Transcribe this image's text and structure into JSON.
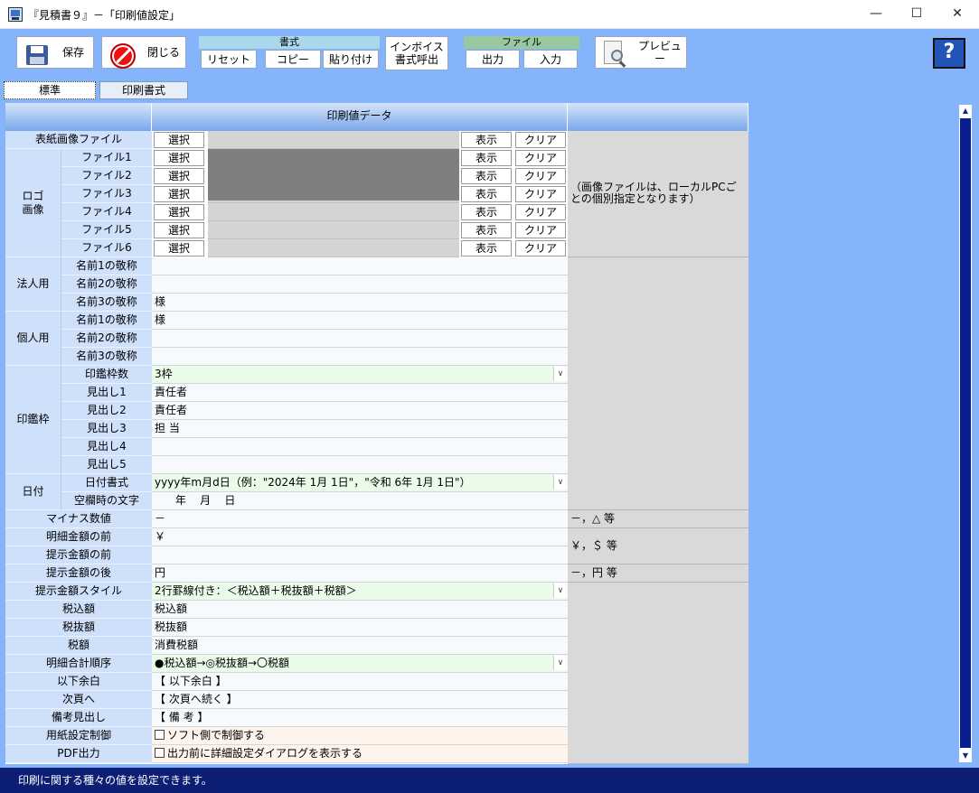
{
  "window": {
    "title": "『見積書９』－「印刷値設定」",
    "minimize": "—",
    "maximize": "☐",
    "close": "✕"
  },
  "toolbar": {
    "save": "保存",
    "close": "閉じる",
    "format_group": "書式",
    "reset": "リセット",
    "copy": "コピー",
    "paste": "貼り付け",
    "invoice": "インボイス\n書式呼出",
    "file_group": "ファイル",
    "export": "出力",
    "import": "入力",
    "preview": "プレビュー",
    "help": "?"
  },
  "tabs": [
    "標準",
    "印刷書式"
  ],
  "grid": {
    "header": "印刷値データ",
    "cover_label": "表紙画像ファイル",
    "logo_group": "ロゴ\n画像",
    "logo_files": [
      "ファイル1",
      "ファイル2",
      "ファイル3",
      "ファイル4",
      "ファイル5",
      "ファイル6"
    ],
    "select": "選択",
    "show": "表示",
    "clear": "クリア",
    "image_note": "（画像ファイルは、ローカルPCごとの個別指定となります）",
    "corp_group": "法人用",
    "personal_group": "個人用",
    "name_titles": [
      "名前1の敬称",
      "名前2の敬称",
      "名前3の敬称"
    ],
    "corp_values": [
      "",
      "",
      "様"
    ],
    "personal_values": [
      "様",
      "",
      ""
    ],
    "stamp_group": "印鑑枠",
    "stamp_count_label": "印鑑枠数",
    "stamp_count_value": "3枠",
    "stamp_heads": [
      "見出し1",
      "見出し2",
      "見出し3",
      "見出し4",
      "見出し5"
    ],
    "stamp_head_values": [
      "責任者",
      "責任者",
      "担 当",
      "",
      ""
    ],
    "date_group": "日付",
    "date_format_label": "日付書式",
    "date_format_value": "yyyy年m月d日（例：\"2024年 1月 1日\"，\"令和 6年 1月 1日\"）",
    "blank_label": "空欄時の文字",
    "blank_value": "      年    月    日",
    "minus_label": "マイナス数値",
    "minus_value": "－",
    "minus_note": "－，△ 等",
    "detail_before_label": "明細金額の前",
    "detail_before_value": "￥",
    "currency_note": "￥，＄ 等",
    "present_before_label": "提示金額の前",
    "present_before_value": "",
    "present_after_label": "提示金額の後",
    "present_after_value": "円",
    "after_note": "－，円 等",
    "style_label": "提示金額スタイル",
    "style_value": "2行罫線付き：＜税込額＋税抜額＋税額＞",
    "taxin_label": "税込額",
    "taxin_value": "税込額",
    "taxex_label": "税抜額",
    "taxex_value": "税抜額",
    "tax_label": "税額",
    "tax_value": "消費税額",
    "order_label": "明細合計順序",
    "order_value": "●税込額→◎税抜額→〇税額",
    "below_label": "以下余白",
    "below_value": "【 以下余白 】",
    "next_label": "次頁へ",
    "next_value": "【 次頁へ続く 】",
    "remark_label": "備考見出し",
    "remark_value": "【 備 考 】",
    "paper_label": "用紙設定制御",
    "paper_value": "ソフト側で制御する",
    "pdf_label": "PDF出力",
    "pdf_value": "出力前に詳細設定ダイアログを表示する"
  },
  "status": "印刷に関する種々の値を設定できます。"
}
